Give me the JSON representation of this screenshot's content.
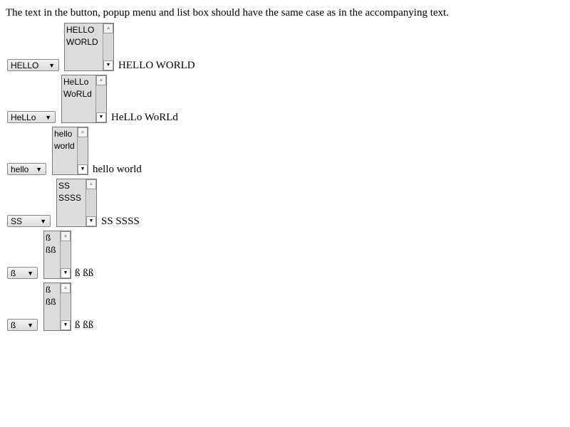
{
  "intro": "The text in the button, popup menu and list box should have the same case as in the accompanying text.",
  "icons": {
    "dropdown_arrow": "▼",
    "scroll_up": "▲",
    "scroll_down": "▼"
  },
  "rows": [
    {
      "popup_value": "HELLO",
      "list_items": [
        "HELLO",
        "WORLD"
      ],
      "caption": "HELLO WORLD"
    },
    {
      "popup_value": "HeLLo",
      "list_items": [
        "HeLLo",
        "WoRLd"
      ],
      "caption": "HeLLo WoRLd"
    },
    {
      "popup_value": "hello",
      "list_items": [
        "hello",
        "world"
      ],
      "caption": "hello world"
    },
    {
      "popup_value": "SS",
      "list_items": [
        "SS",
        "SSSS"
      ],
      "caption": "SS SSSS"
    },
    {
      "popup_value": "ß",
      "list_items": [
        "ß",
        "ßß"
      ],
      "caption": "ß ßß"
    },
    {
      "popup_value": "ß",
      "list_items": [
        "ß",
        "ßß"
      ],
      "caption": "ß ßß"
    }
  ]
}
